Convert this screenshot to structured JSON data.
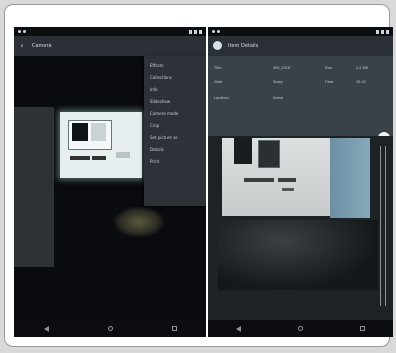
{
  "left_screen": {
    "statusbar": {
      "time": "",
      "icons": [
        "signal-icon",
        "wifi-icon",
        "battery-icon"
      ]
    },
    "appbar": {
      "title": "Camera"
    },
    "menu": {
      "items": [
        "Effects",
        "Collections",
        "Info",
        "Slideshow",
        "Camera mode",
        "Crop",
        "Set picture as",
        "Details",
        "Print"
      ]
    }
  },
  "right_screen": {
    "statusbar": {
      "time": ""
    },
    "appbar": {
      "title": "Item Details"
    },
    "info": {
      "rows": [
        {
          "label": "Title",
          "value": "IMG_2016",
          "extra": "Size",
          "extra_value": "1.2 MB"
        },
        {
          "label": "Date",
          "value": "Today",
          "extra": "Time",
          "extra_value": "10:42"
        },
        {
          "label": "Location",
          "value": "Home",
          "extra": "",
          "extra_value": ""
        }
      ]
    }
  },
  "colors": {
    "appbar": "#2a3036",
    "menu": "#2c3238",
    "screen_bg": "#0b0d11"
  }
}
